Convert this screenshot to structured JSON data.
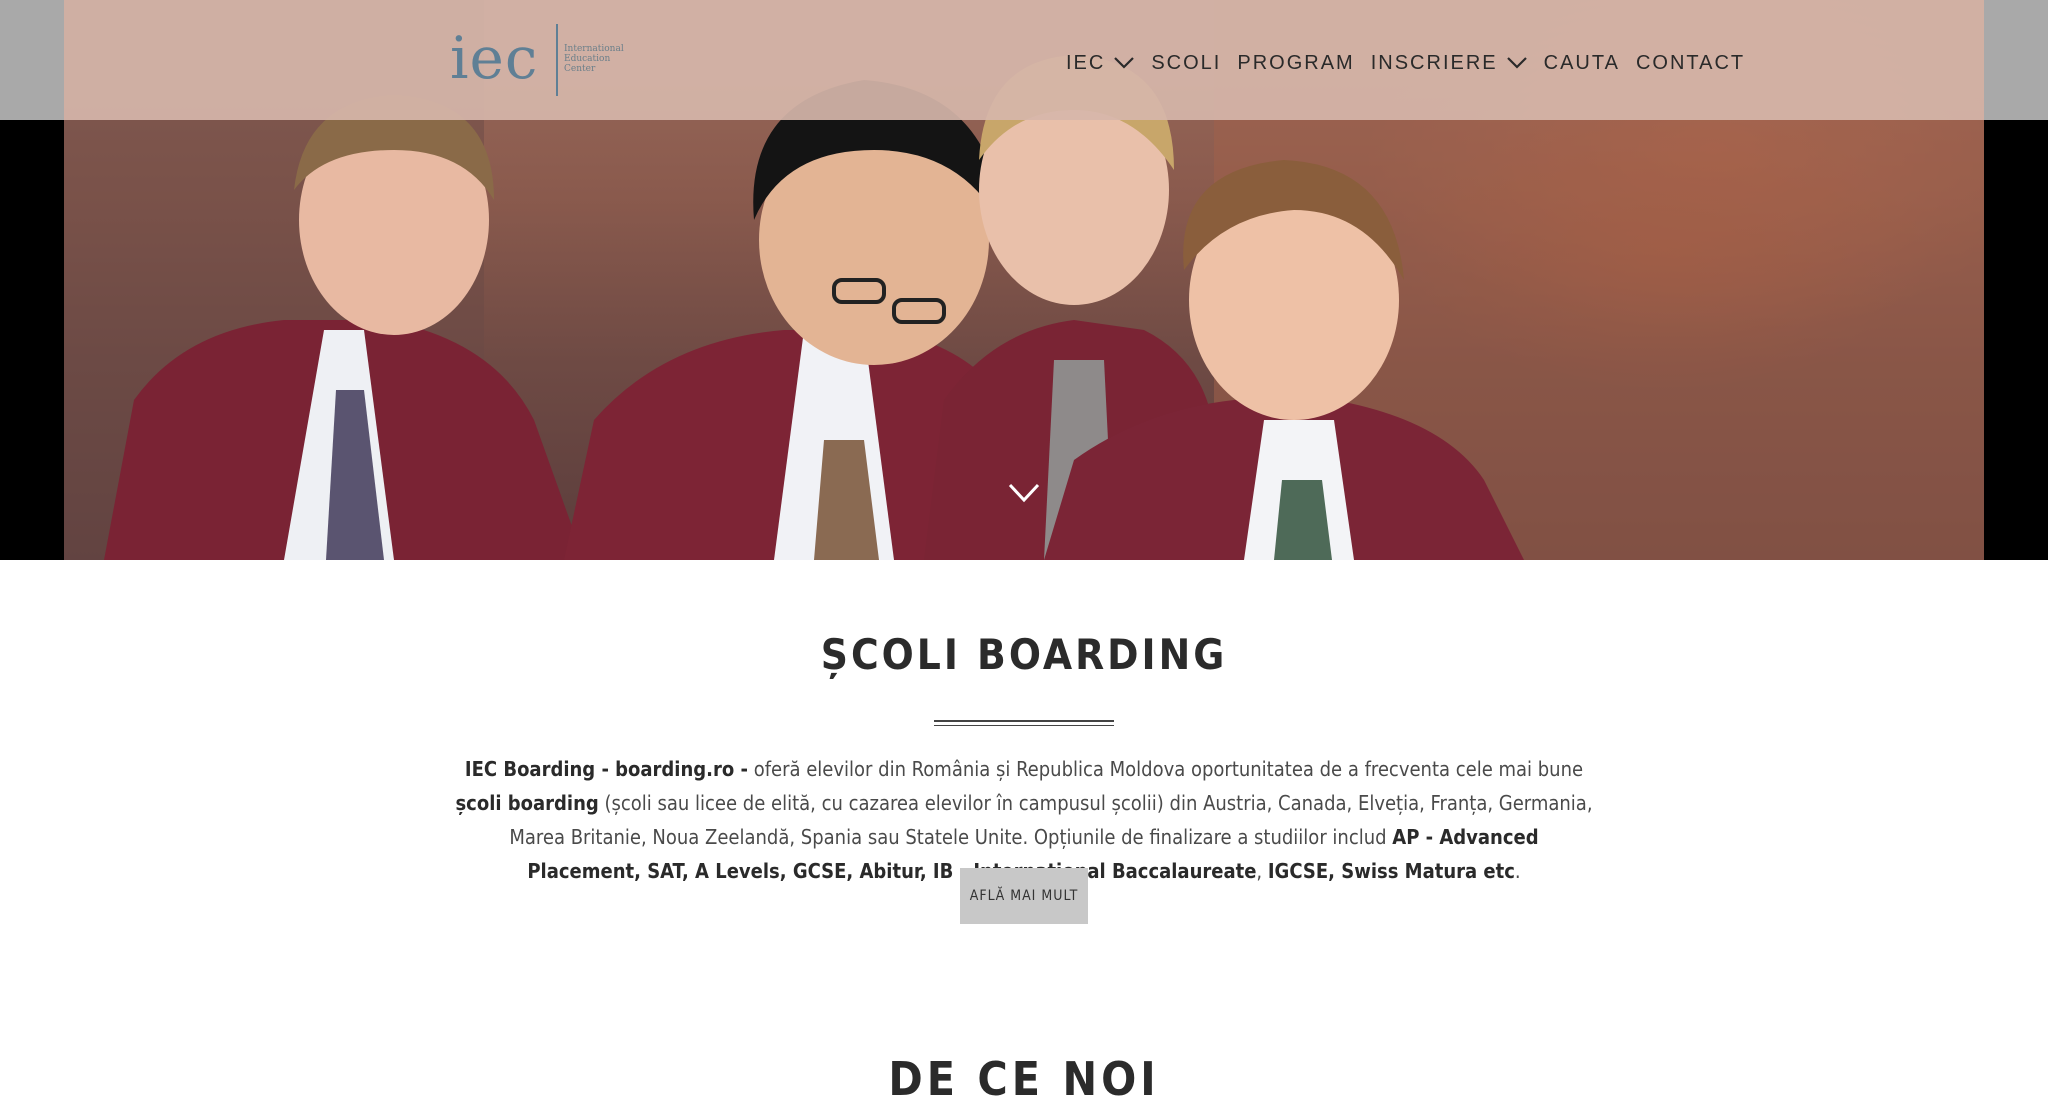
{
  "brand": {
    "logo_mark": "iec",
    "logo_lines": [
      "International",
      "Education",
      "Center"
    ],
    "logo_color": "#5f7f95"
  },
  "nav": {
    "items": [
      {
        "label": "IEC",
        "has_dropdown": true
      },
      {
        "label": "SCOLI",
        "has_dropdown": false
      },
      {
        "label": "PROGRAM",
        "has_dropdown": false
      },
      {
        "label": "INSCRIERE",
        "has_dropdown": true
      },
      {
        "label": "CAUTA",
        "has_dropdown": false
      },
      {
        "label": "CONTACT",
        "has_dropdown": false
      }
    ],
    "bar_color": "#d6b6aa"
  },
  "hero": {
    "image": "photo of students in maroon blazers and striped ties",
    "scroll_icon": "chevron-down-icon"
  },
  "section": {
    "title": "ȘCOLI BOARDING",
    "intro": {
      "p1_bold": "IEC Boarding - boarding.ro -",
      "p2": " oferă elevilor din România și Republica Moldova oportunitatea de a frecventa cele mai bune ",
      "p3_bold": "școli boarding",
      "p4": " (școli sau licee de elită, cu cazarea elevilor în campusul școlii) din Austria, Canada, Elveția, Franța, Germania, Marea Britanie, Noua Zeelandă, Spania sau Statele Unite. Opțiunile de finalizare a studiilor includ ",
      "p5_bold": "AP - Advanced Placement, SAT, A Levels, GCSE, Abitur, IB - International Baccalaureate",
      "p6": ", ",
      "p7_bold": "IGCSE, Swiss Matura etc",
      "p8": "."
    },
    "cta_label": "AFLĂ MAI MULT",
    "cta_color": "#c8c8c8"
  },
  "next_section": {
    "title": "DE CE NOI"
  }
}
